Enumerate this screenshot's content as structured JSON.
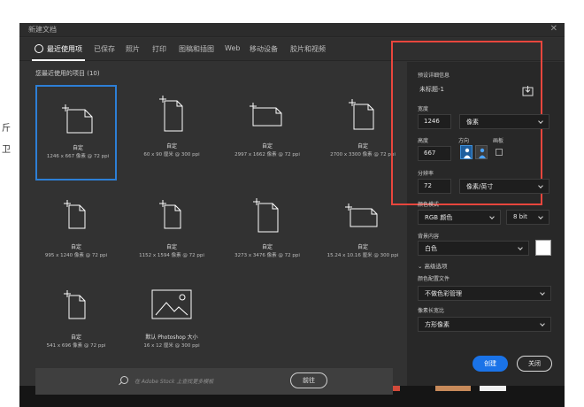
{
  "window": {
    "title": "新建文档"
  },
  "tabs": [
    {
      "label": "最近使用项"
    },
    {
      "label": "已保存"
    },
    {
      "label": "照片"
    },
    {
      "label": "打印"
    },
    {
      "label": "图稿和插图"
    },
    {
      "label": "Web"
    },
    {
      "label": "移动设备"
    },
    {
      "label": "胶片和视频"
    }
  ],
  "recent": {
    "title": "您最近使用的项目 (10)",
    "items": [
      {
        "name": "自定",
        "size": "1246 x 667 像素 @ 72 ppi"
      },
      {
        "name": "自定",
        "size": "60 x 90 厘米 @ 300 ppi"
      },
      {
        "name": "自定",
        "size": "2997 x 1662 像素 @ 72 ppi"
      },
      {
        "name": "自定",
        "size": "2700 x 3300 像素 @ 72 ppi"
      },
      {
        "name": "自定",
        "size": "995 x 1240 像素 @ 72 ppi"
      },
      {
        "name": "自定",
        "size": "1152 x 1594 像素 @ 72 ppi"
      },
      {
        "name": "自定",
        "size": "3273 x 3476 像素 @ 72 ppi"
      },
      {
        "name": "自定",
        "size": "15.24 x 10.16 厘米 @ 300 ppi"
      },
      {
        "name": "自定",
        "size": "541 x 696 像素 @ 72 ppi"
      },
      {
        "name": "默认 Photoshop 大小",
        "size": "16 x 12 厘米 @ 300 ppi"
      }
    ]
  },
  "search": {
    "placeholder": "在 Adobe Stock 上查找更多模板",
    "button": "前往"
  },
  "preset": {
    "section_title": "预设详细信息",
    "doc_name": "未标题-1",
    "width_label": "宽度",
    "width_value": "1246",
    "width_unit": "像素",
    "height_label": "高度",
    "height_value": "667",
    "orientation_label": "方向",
    "artboard_label": "画板",
    "resolution_label": "分辨率",
    "resolution_value": "72",
    "resolution_unit": "像素/英寸",
    "color_mode_label": "颜色模式",
    "color_mode_value": "RGB 颜色",
    "bit_depth": "8 bit",
    "background_label": "背景内容",
    "background_value": "白色",
    "advanced_label": "高级选项",
    "color_profile_label": "颜色配置文件",
    "color_profile_value": "不做色彩管理",
    "pixel_aspect_label": "像素长宽比",
    "pixel_aspect_value": "方形像素"
  },
  "actions": {
    "create": "创建",
    "close": "关闭"
  },
  "edge_glyphs": [
    "斤",
    "卫"
  ],
  "colors": {
    "accent": "#1a73e8",
    "highlight": "#e8463d",
    "selection": "#2d7fd6"
  }
}
